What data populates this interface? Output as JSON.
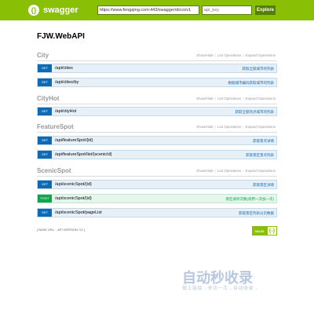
{
  "header": {
    "logo_mark": "{}",
    "logo_text": "swagger",
    "url_value": "https://www.fengqing.com:443/swagger/docs/v1",
    "api_key_placeholder": "api_key",
    "explore_label": "Explore",
    "bg_color": "#89bf04"
  },
  "api_title": "FJW.WebAPI",
  "resource_controls": {
    "show_hide": "Show/Hide",
    "list_ops": "List Operations",
    "expand_ops": "Expand Operations",
    "sep": "|"
  },
  "resources": [
    {
      "name": "City",
      "operations": [
        {
          "method": "GET",
          "path": "/api/cities",
          "summary": "获取全部城市的列表"
        },
        {
          "method": "GET",
          "path": "/api/cities/by",
          "summary": "根据城市编码获取城市的列表"
        }
      ]
    },
    {
      "name": "CityHot",
      "operations": [
        {
          "method": "GET",
          "path": "/api/cityHot",
          "summary": "获取全部热点城市的列表"
        }
      ]
    },
    {
      "name": "FeatureSpot",
      "operations": [
        {
          "method": "GET",
          "path": "/api/featureSpot/{id}",
          "summary": "获取景点详情"
        },
        {
          "method": "GET",
          "path": "/api/featureSpot/list/{scenicId}",
          "summary": "获取景区景点列表"
        }
      ]
    },
    {
      "name": "ScenicSpot",
      "operations": [
        {
          "method": "GET",
          "path": "/api/scenicSpot/{id}",
          "summary": "获取景区详情"
        },
        {
          "method": "POST",
          "path": "/api/scenicSpot/{id}",
          "summary": "景区收听次数(调用一次加一次)"
        },
        {
          "method": "GET",
          "path": "/api/scenicSpot/pageList",
          "summary": "获取景区列表分页数据"
        }
      ]
    }
  ],
  "footer": {
    "base_url": "[ BASE URL: , API VERSION: V1 ]",
    "valid_label": "VALID",
    "valid_icon": "{-}"
  },
  "watermark": {
    "main": "自动秒收录",
    "sub": "做上链接→来访一次→自动收录→"
  },
  "colors": {
    "get": "#0f6ab4",
    "post": "#10a54a"
  }
}
